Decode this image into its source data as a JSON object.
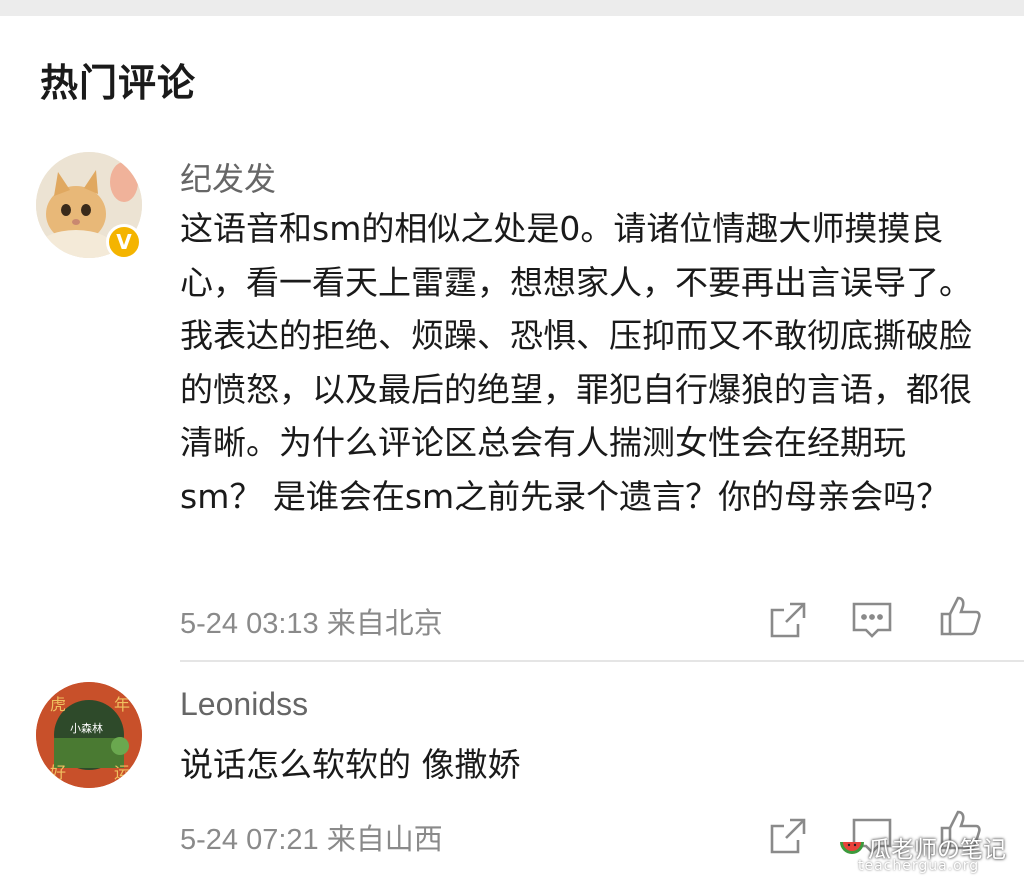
{
  "section_title": "热门评论",
  "comments": [
    {
      "username": "纪发发",
      "verified_badge": "V",
      "text": "这语音和sm的相似之处是0。请诸位情趣大师摸摸良心，看一看天上雷霆，想想家人，不要再出言误导了。我表达的拒绝、烦躁、恐惧、压抑而又不敢彻底撕破脸的愤怒，以及最后的绝望，罪犯自行爆狼的言语，都很清晰。为什么评论区总会有人揣测女性会在经期玩sm？ 是谁会在sm之前先录个遗言？你的母亲会吗？",
      "meta": "5-24 03:13 来自北京",
      "actions": [
        "share-icon",
        "comment-icon",
        "like-icon"
      ]
    },
    {
      "username": "Leonidss",
      "avatar_text": {
        "tl": "虎",
        "tr": "年",
        "center": "小森林",
        "bl": "好",
        "br": "运"
      },
      "text": "说话怎么软软的 像撒娇",
      "meta": "5-24 07:21 来自山西",
      "actions": [
        "share-icon",
        "comment-icon",
        "like-icon"
      ]
    }
  ],
  "watermark": {
    "label": "瓜老师の笔记",
    "url": "teachergua.org"
  },
  "colors": {
    "background": "#ffffff",
    "meta": "#8a8a8a",
    "username": "#666666",
    "verified": "#f4b400"
  }
}
